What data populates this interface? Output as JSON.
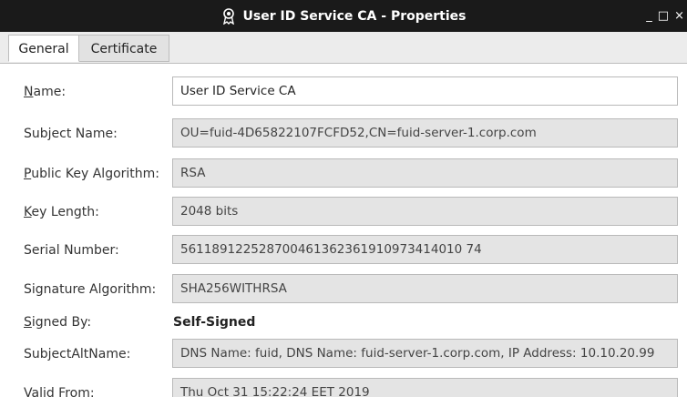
{
  "window": {
    "title": "User ID Service CA - Properties",
    "title_icon": "certificate-ribbon-icon",
    "controls": [
      "_",
      "□",
      "×"
    ]
  },
  "tabs": [
    {
      "label": "General",
      "active": true
    },
    {
      "label": "Certificate",
      "active": false
    }
  ],
  "fields": {
    "name": {
      "label_first": "N",
      "label_rest": "ame:",
      "value": "User ID Service CA"
    },
    "subject_name": {
      "label": "Subject Name:",
      "value": "OU=fuid-4D65822107FCFD52,CN=fuid-server-1.corp.com"
    },
    "public_key_algorithm": {
      "label_first": "P",
      "label_rest": "ublic Key Algorithm:",
      "value": "RSA"
    },
    "key_length": {
      "label_first": "K",
      "label_rest": "ey Length:",
      "value": "2048 bits"
    },
    "serial_number": {
      "label": "Serial Number:",
      "value": "561189122528700461362361910973414010 74"
    },
    "signature_algorithm": {
      "label": "Signature Algorithm:",
      "value": "SHA256WITHRSA"
    },
    "signed_by": {
      "label_first": "S",
      "label_rest": "igned By:",
      "value": "Self-Signed"
    },
    "subject_alt_name": {
      "label": "SubjectAltName:",
      "value": "DNS Name: fuid, DNS Name: fuid-server-1.corp.com, IP Address: 10.10.20.99"
    },
    "valid_from": {
      "label": "Valid From:",
      "value": "Thu Oct 31 15:22:24 EET 2019"
    }
  }
}
